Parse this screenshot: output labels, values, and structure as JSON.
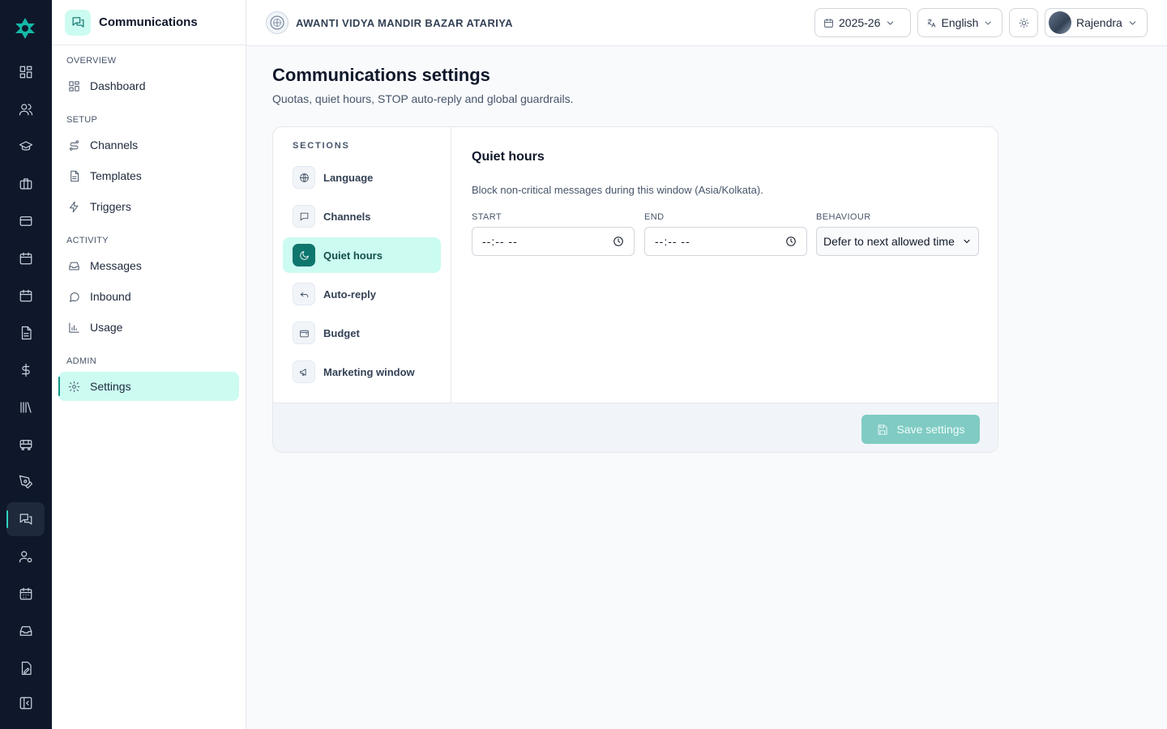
{
  "rail": {
    "items": [
      {
        "icon": "dashboard-icon"
      },
      {
        "icon": "users-icon"
      },
      {
        "icon": "graduation-cap-icon"
      },
      {
        "icon": "briefcase-icon"
      },
      {
        "icon": "credit-card-icon"
      },
      {
        "icon": "calendar-icon"
      },
      {
        "icon": "calendar-check-icon"
      },
      {
        "icon": "document-icon"
      },
      {
        "icon": "dollar-icon"
      },
      {
        "icon": "library-icon"
      },
      {
        "icon": "bus-icon"
      },
      {
        "icon": "pen-tool-icon"
      },
      {
        "icon": "messages-icon",
        "active": true
      },
      {
        "icon": "user-cog-icon"
      },
      {
        "icon": "calendar-grid-icon"
      },
      {
        "icon": "inbox-tray-icon"
      },
      {
        "icon": "file-edit-icon"
      },
      {
        "icon": "collapse-panel-icon"
      }
    ]
  },
  "sidebar": {
    "title": "Communications",
    "groups": {
      "overview": "OVERVIEW",
      "setup": "SETUP",
      "activity": "ACTIVITY",
      "admin": "ADMIN"
    },
    "items": {
      "dashboard": "Dashboard",
      "channels": "Channels",
      "templates": "Templates",
      "triggers": "Triggers",
      "messages": "Messages",
      "inbound": "Inbound",
      "usage": "Usage",
      "settings": "Settings"
    },
    "active": "settings"
  },
  "topbar": {
    "school_name": "AWANTI VIDYA MANDIR BAZAR ATARIYA",
    "year": "2025-26",
    "language": "English",
    "user": "Rajendra"
  },
  "page": {
    "title": "Communications settings",
    "subtitle": "Quotas, quiet hours, STOP auto-reply and global guardrails."
  },
  "sections": {
    "heading": "SECTIONS",
    "items": [
      "Language",
      "Channels",
      "Quiet hours",
      "Auto-reply",
      "Budget",
      "Marketing window"
    ],
    "active": "Quiet hours"
  },
  "quiet_hours": {
    "title": "Quiet hours",
    "description": "Block non-critical messages during this window (Asia/Kolkata).",
    "start_label": "START",
    "start_value": "--:-- --",
    "end_label": "END",
    "end_value": "--:-- --",
    "behaviour_label": "BEHAVIOUR",
    "behaviour_value": "Defer to next allowed time"
  },
  "footer": {
    "save_label": "Save settings"
  },
  "colors": {
    "rail_bg": "#0f172a",
    "accent": "#0f766e",
    "accent_light": "#ccfbf1",
    "save_disabled": "#80cbc4"
  }
}
